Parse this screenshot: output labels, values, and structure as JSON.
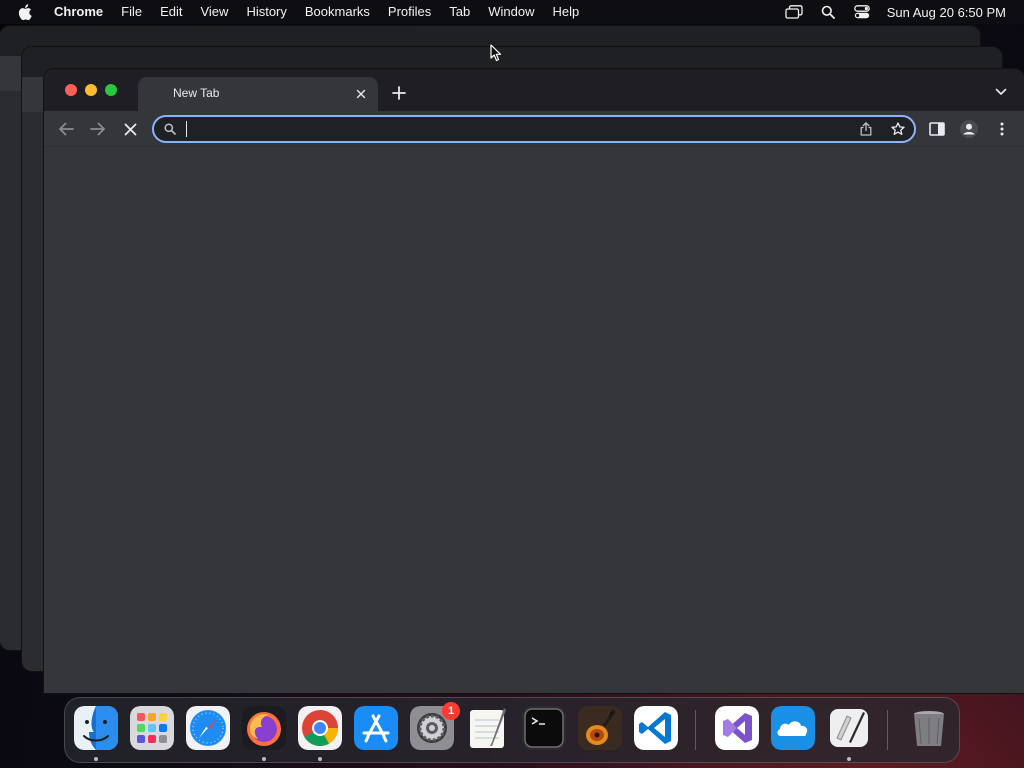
{
  "menubar": {
    "app_name": "Chrome",
    "items": [
      "File",
      "Edit",
      "View",
      "History",
      "Bookmarks",
      "Profiles",
      "Tab",
      "Window",
      "Help"
    ],
    "clock": "Sun Aug 20  6:50 PM",
    "icons": [
      "apple-icon",
      "screen-mirroring-icon",
      "spotlight-search-icon",
      "control-center-icon"
    ]
  },
  "browser": {
    "tab_title": "New Tab",
    "omnibox_value": "",
    "icons": [
      "back-icon",
      "forward-icon",
      "stop-icon",
      "search-icon",
      "share-icon",
      "bookmark-star-icon",
      "side-panel-icon",
      "profile-icon",
      "more-menu-icon",
      "tab-search-icon",
      "new-tab-icon",
      "close-tab-icon"
    ],
    "accent_color": "#8ab4f8",
    "background_color": "#35363a"
  },
  "dock": {
    "apps": [
      "Finder",
      "Launchpad",
      "Safari",
      "Firefox",
      "Google Chrome",
      "App Store",
      "System Settings",
      "TextEdit",
      "Terminal",
      "GarageBand",
      "Visual Studio Code",
      "Visual Studio",
      "OneDrive",
      "Script Editor",
      "Trash"
    ],
    "settings_badge": "1"
  }
}
